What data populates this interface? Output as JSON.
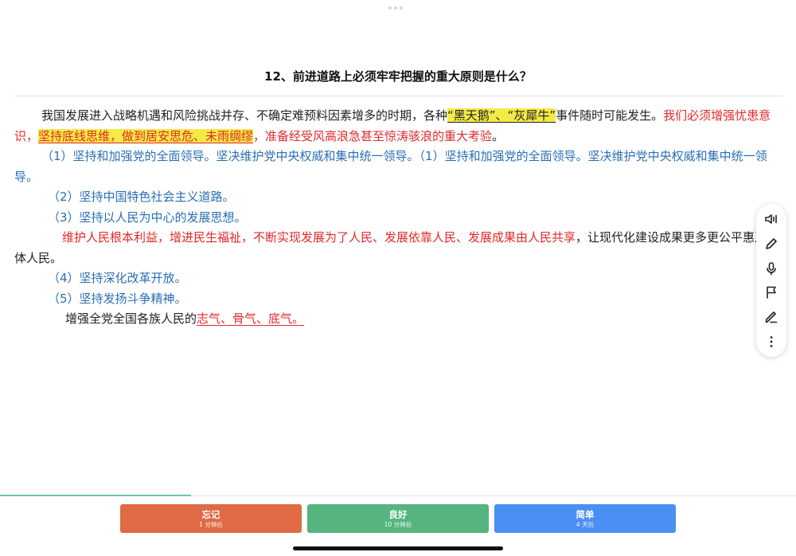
{
  "question": {
    "title": "12、前进道路上必须牢牢把握的重大原则是什么？"
  },
  "answer": {
    "intro": {
      "t1": "我国发展进入战略机遇和风险挑战并存、不确定难预料因素增多的时期，各种",
      "t2_hl": "“黑天鹅”、“灰犀牛”",
      "t3": "事件随时可能发生。",
      "t4_red": "我们必须增强忧患意识，",
      "t5_red_hl": "坚持底线思维，做到居安思危、未雨绸缪",
      "t6_red": "，准备经受风高浪急甚至惊涛骇浪的重大考验",
      "t7": "。"
    },
    "p1": "（1）坚持和加强党的全面领导。坚决维护党中央权威和集中统一领导。（1）坚持和加强党的全面领导。坚决维护党中央权威和集中统一领导。",
    "p2": "（2）坚持中国特色社会主义道路。",
    "p3": "（3）坚持以人民为中心的发展思想。",
    "p3_detail": {
      "red": "维护人民根本利益，增进民生福祉，不断实现发展为了人民、发展依靠人民、发展成果由人民共享",
      "rest": "，让现代化建设成果更多更公平惠及全体人民。"
    },
    "p4": "（4）坚持深化改革开放。",
    "p5": "（5）坚持发扬斗争精神。",
    "p5_detail": {
      "text": "增强全党全国各族人民的",
      "red_u": "志气、骨气、底气。"
    }
  },
  "toolbar": {
    "icons": [
      "speaker-icon",
      "pencil-icon",
      "microphone-icon",
      "flag-icon",
      "pen-icon",
      "more-icon"
    ]
  },
  "buttons": {
    "forget": {
      "label": "忘记",
      "sub": "1 分钟后"
    },
    "good": {
      "label": "良好",
      "sub": "10 分钟后"
    },
    "easy": {
      "label": "简单",
      "sub": "4 天后"
    }
  },
  "colors": {
    "blue_text": "#2a6fb5",
    "red_text": "#e02a2a",
    "highlight": "#f4ea45",
    "forget": "#df6a44",
    "good": "#55b47f",
    "easy": "#4a8ff2"
  }
}
